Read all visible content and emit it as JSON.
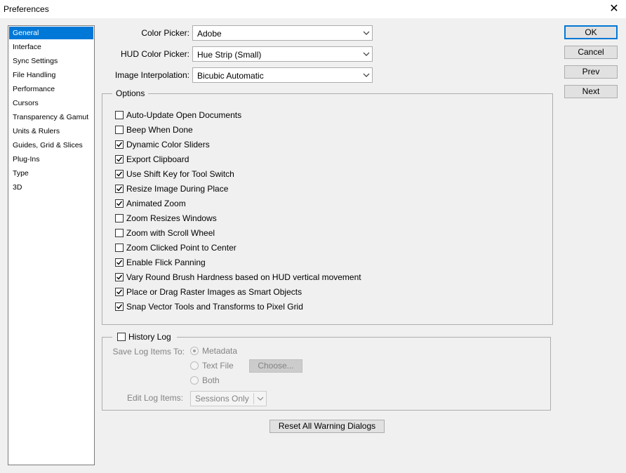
{
  "window": {
    "title": "Preferences",
    "close_glyph": "✕"
  },
  "nav": {
    "items": [
      "General",
      "Interface",
      "Sync Settings",
      "File Handling",
      "Performance",
      "Cursors",
      "Transparency & Gamut",
      "Units & Rulers",
      "Guides, Grid & Slices",
      "Plug-Ins",
      "Type",
      "3D"
    ],
    "selected": "General"
  },
  "general": {
    "color_picker": {
      "label": "Color Picker:",
      "value": "Adobe"
    },
    "hud_color_picker": {
      "label": "HUD Color Picker:",
      "value": "Hue Strip (Small)"
    },
    "image_interpolation": {
      "label": "Image Interpolation:",
      "value": "Bicubic Automatic"
    }
  },
  "options": {
    "legend": "Options",
    "items": [
      {
        "label": "Auto-Update Open Documents",
        "checked": false
      },
      {
        "label": "Beep When Done",
        "checked": false
      },
      {
        "label": "Dynamic Color Sliders",
        "checked": true
      },
      {
        "label": "Export Clipboard",
        "checked": true
      },
      {
        "label": "Use Shift Key for Tool Switch",
        "checked": true
      },
      {
        "label": "Resize Image During Place",
        "checked": true
      },
      {
        "label": "Animated Zoom",
        "checked": true
      },
      {
        "label": "Zoom Resizes Windows",
        "checked": false
      },
      {
        "label": "Zoom with Scroll Wheel",
        "checked": false
      },
      {
        "label": "Zoom Clicked Point to Center",
        "checked": false
      },
      {
        "label": "Enable Flick Panning",
        "checked": true
      },
      {
        "label": "Vary Round Brush Hardness based on HUD vertical movement",
        "checked": true
      },
      {
        "label": "Place or Drag Raster Images as Smart Objects",
        "checked": true
      },
      {
        "label": "Snap Vector Tools and Transforms to Pixel Grid",
        "checked": true
      }
    ]
  },
  "history_log": {
    "label": "History Log",
    "checked": false,
    "save_to_label": "Save Log Items To:",
    "save_options": [
      {
        "label": "Metadata",
        "selected": true
      },
      {
        "label": "Text File",
        "selected": false
      },
      {
        "label": "Both",
        "selected": false
      }
    ],
    "choose_button": "Choose...",
    "edit_label": "Edit Log Items:",
    "edit_value": "Sessions Only"
  },
  "buttons": {
    "ok": "OK",
    "cancel": "Cancel",
    "prev": "Prev",
    "next": "Next",
    "reset_warnings": "Reset All Warning Dialogs"
  },
  "colors": {
    "selection": "#0078d7",
    "dialog_bg": "#f0f0f0",
    "disabled_text": "#838383"
  }
}
